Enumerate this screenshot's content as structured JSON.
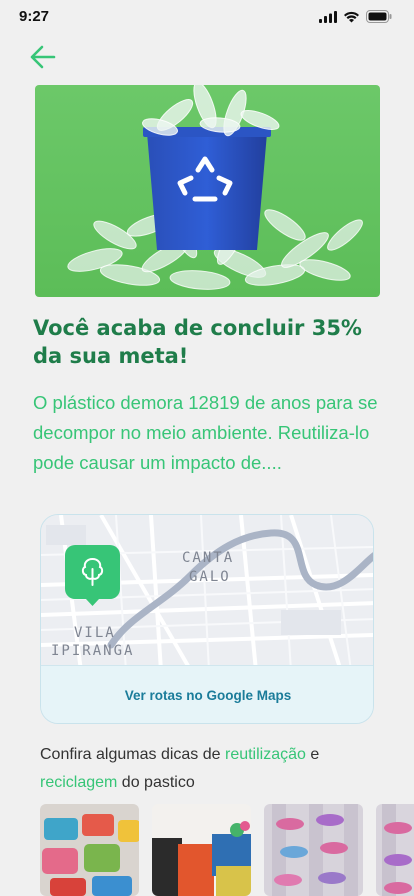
{
  "status": {
    "time": "9:27"
  },
  "hero": {
    "alt": "Lixeira azul de reciclagem com garrafas plásticas"
  },
  "headline": "Você acaba de concluir 35% da sua meta!",
  "subtext": "O plástico demora 12819 de anos para se decompor no meio ambiente. Reutiliza-lo pode causar um impacto de....",
  "map": {
    "labels": {
      "canta": "CANTA",
      "galo": "GALO",
      "vila": "VILA",
      "ipiranga": "IPIRANGA"
    },
    "link": "Ver rotas no Google Maps"
  },
  "tips": {
    "prefix": "Confira algumas dicas de ",
    "link1": "reutilização",
    "mid": " e ",
    "link2": "reciclagem",
    "suffix": " do pastico"
  },
  "colors": {
    "accent": "#37c577",
    "heading": "#1f7d4a",
    "map_link": "#1b7c9a"
  }
}
